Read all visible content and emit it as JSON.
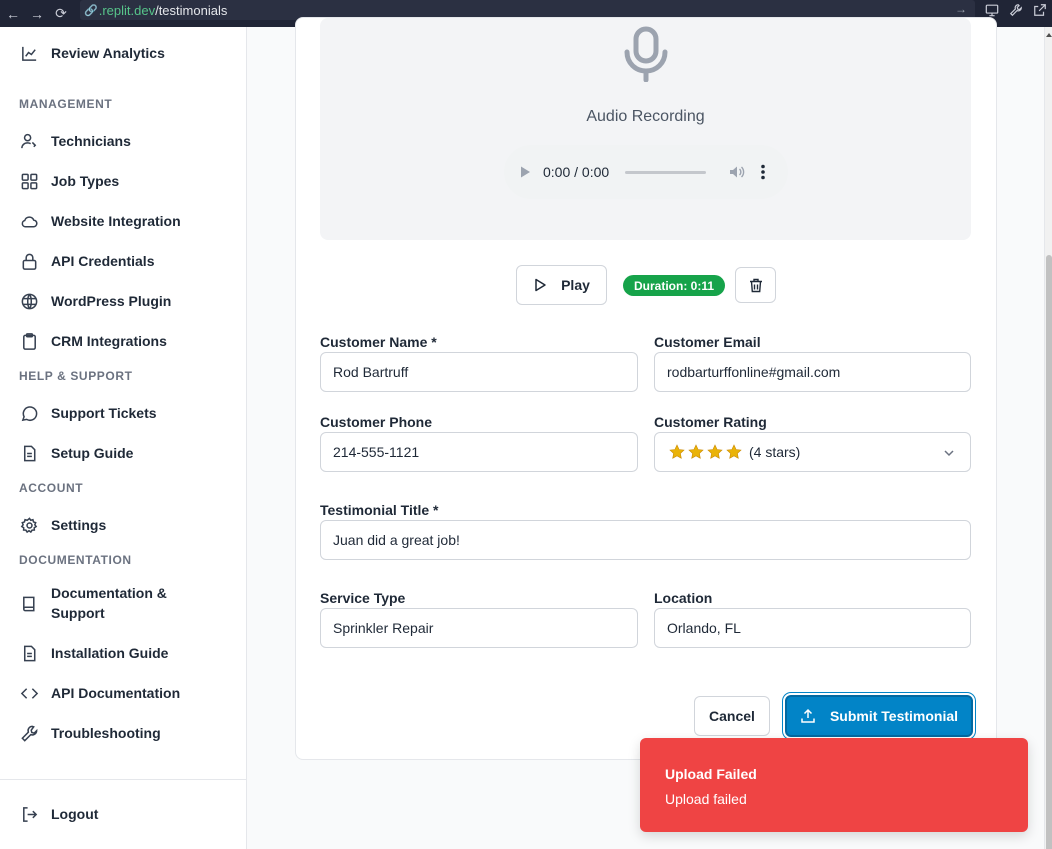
{
  "browser": {
    "url_domain": ".replit.dev",
    "url_path": "/testimonials"
  },
  "sidebar": {
    "top_item": "Review Analytics",
    "sections": {
      "management": "MANAGEMENT",
      "help": "HELP & SUPPORT",
      "account": "ACCOUNT",
      "documentation": "DOCUMENTATION"
    },
    "management_items": [
      "Technicians",
      "Job Types",
      "Website Integration",
      "API Credentials",
      "WordPress Plugin",
      "CRM Integrations"
    ],
    "help_items": [
      "Support Tickets",
      "Setup Guide"
    ],
    "account_items": [
      "Settings"
    ],
    "documentation_items": [
      "Documentation &",
      "Support",
      "Installation Guide",
      "API Documentation",
      "Troubleshooting"
    ],
    "logout": "Logout"
  },
  "audio": {
    "label": "Audio Recording",
    "player_time": "0:00 / 0:00",
    "play_label": "Play",
    "duration_badge": "Duration: 0:11"
  },
  "form": {
    "customer_name_label": "Customer Name *",
    "customer_name_value": "Rod Bartruff",
    "customer_email_label": "Customer Email",
    "customer_email_value": "rodbarturffonline#gmail.com",
    "customer_phone_label": "Customer Phone",
    "customer_phone_value": "214-555-1121",
    "customer_rating_label": "Customer Rating",
    "customer_rating_stars": 4,
    "customer_rating_text": "(4 stars)",
    "title_label": "Testimonial Title *",
    "title_value": "Juan did a great job!",
    "service_type_label": "Service Type",
    "service_type_value": "Sprinkler Repair",
    "location_label": "Location",
    "location_value": "Orlando, FL",
    "cancel_label": "Cancel",
    "submit_label": "Submit Testimonial"
  },
  "toast": {
    "title": "Upload Failed",
    "message": "Upload failed"
  },
  "colors": {
    "primary": "#0284c7",
    "success": "#16a34a",
    "error": "#ef4444",
    "star": "#eab308"
  }
}
